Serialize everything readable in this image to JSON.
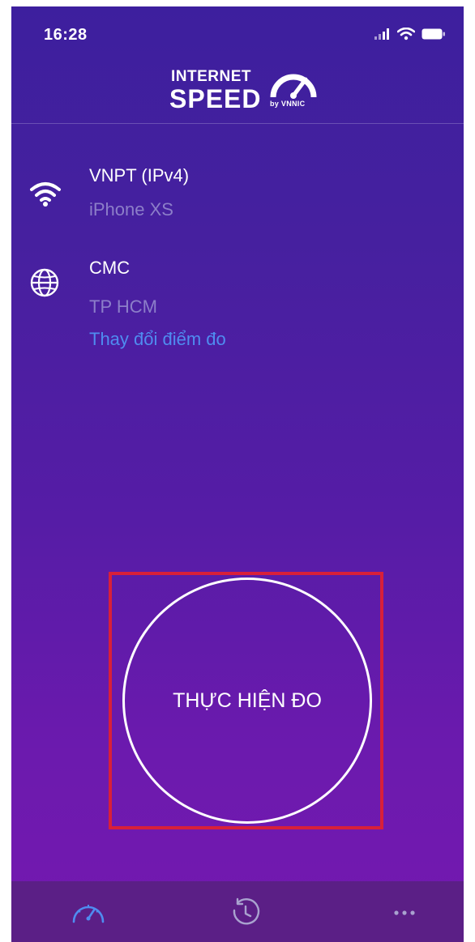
{
  "status_bar": {
    "time": "16:28",
    "icons": [
      "cellular-signal-icon",
      "wifi-icon",
      "battery-icon"
    ]
  },
  "header": {
    "logo_line1": "INTERNET",
    "logo_line2": "SPEED",
    "logo_by": "by VNNIC",
    "logo_icon": "speedometer-icon"
  },
  "network": {
    "icon": "wifi-icon",
    "provider": "VNPT (IPv4)",
    "device": "iPhone XS"
  },
  "server": {
    "icon": "globe-icon",
    "name": "CMC",
    "location": "TP HCM",
    "change_link": "Thay đổi điểm đo"
  },
  "start_button": {
    "label": "THỰC HIỆN ĐO"
  },
  "tab_bar": {
    "tabs": [
      {
        "icon": "speedometer-icon",
        "active": true
      },
      {
        "icon": "history-icon",
        "active": false
      },
      {
        "icon": "more-icon",
        "active": false
      }
    ]
  },
  "colors": {
    "background_top": "#3d1f9e",
    "background_bottom": "#7418b0",
    "subtitle": "#8c7ec9",
    "link": "#4f8cf0",
    "highlight": "#d8203a",
    "tab_bar": "#5b1f86",
    "tab_active": "#4f8cf0"
  }
}
